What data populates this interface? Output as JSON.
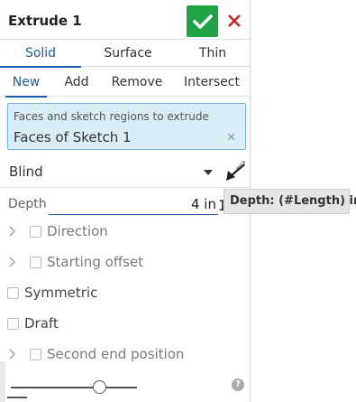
{
  "header": {
    "title": "Extrude 1",
    "ok_icon": "checkmark-icon",
    "cancel_icon": "close-icon",
    "ok_color": "#1fa347",
    "cancel_color": "#c62828"
  },
  "type_tabs": [
    {
      "label": "Solid",
      "active": true
    },
    {
      "label": "Surface",
      "active": false
    },
    {
      "label": "Thin",
      "active": false
    }
  ],
  "operation_tabs": [
    {
      "label": "New",
      "active": true
    },
    {
      "label": "Add",
      "active": false
    },
    {
      "label": "Remove",
      "active": false
    },
    {
      "label": "Intersect",
      "active": false
    }
  ],
  "selection": {
    "label": "Faces and sketch regions to extrude",
    "value": "Faces of Sketch 1",
    "clear_glyph": "✕"
  },
  "end_type": {
    "value": "Blind",
    "flip_icon": "flip-direction-icon"
  },
  "depth": {
    "label": "Depth",
    "value": "4 in",
    "tooltip": "Depth: (#Length) in"
  },
  "options": [
    {
      "label": "Direction",
      "expandable": true,
      "checked": false
    },
    {
      "label": "Starting offset",
      "expandable": true,
      "checked": false
    },
    {
      "label": "Symmetric",
      "expandable": false,
      "checked": false
    },
    {
      "label": "Draft",
      "expandable": false,
      "checked": false
    },
    {
      "label": "Second end position",
      "expandable": true,
      "checked": false
    }
  ],
  "footer": {
    "help_glyph": "?",
    "slider_level": 0.7
  },
  "colors": {
    "accent": "#1c5fb3",
    "selection_bg": "#d9eef7",
    "selection_border": "#6cb6d8"
  }
}
